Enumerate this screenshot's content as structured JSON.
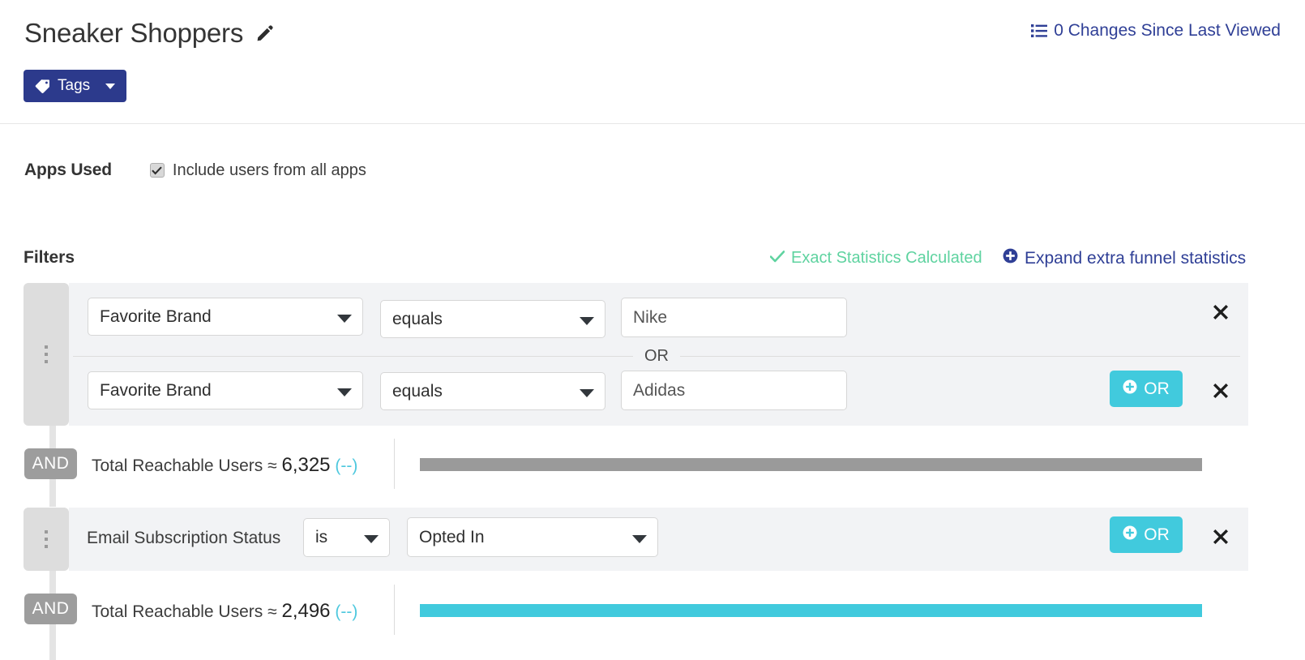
{
  "header": {
    "title": "Sneaker Shoppers",
    "edit_icon": "pencil-icon",
    "tags_label": "Tags",
    "tags_icon": "tag-icon",
    "changes_link": "0 Changes Since Last Viewed",
    "changes_icon": "list-icon"
  },
  "apps": {
    "label": "Apps Used",
    "checkbox_label": "Include users from all apps",
    "checkbox_checked": true
  },
  "filters": {
    "label": "Filters",
    "exact_stats": "Exact Statistics Calculated",
    "exact_stats_icon": "check-icon",
    "expand_stats": "Expand extra funnel statistics",
    "expand_stats_icon": "plus-circle-icon",
    "or_divider_label": "OR",
    "or_button_label": "OR",
    "and_label": "AND",
    "delete_icon": "close-icon",
    "drag_icon": "drag-handle-icon"
  },
  "group1": {
    "row1": {
      "field": "Favorite Brand",
      "operator": "equals",
      "value": "Nike"
    },
    "row2": {
      "field": "Favorite Brand",
      "operator": "equals",
      "value": "Adidas"
    }
  },
  "reach1": {
    "prefix": "Total Reachable Users ≈ ",
    "count": "6,325",
    "delta": "(--)",
    "bar_color": "#9a9a9a"
  },
  "group2": {
    "row1": {
      "field": "Email Subscription Status",
      "operator": "is",
      "value": "Opted In"
    }
  },
  "reach2": {
    "prefix": "Total Reachable Users ≈ ",
    "count": "2,496",
    "delta": "(--)",
    "bar_color": "#41cadd"
  },
  "colors": {
    "brand_navy": "#2c3a8c",
    "accent_cyan": "#41cadd",
    "success_green": "#5fd3a0",
    "neutral_grey": "#9a9a9a"
  }
}
